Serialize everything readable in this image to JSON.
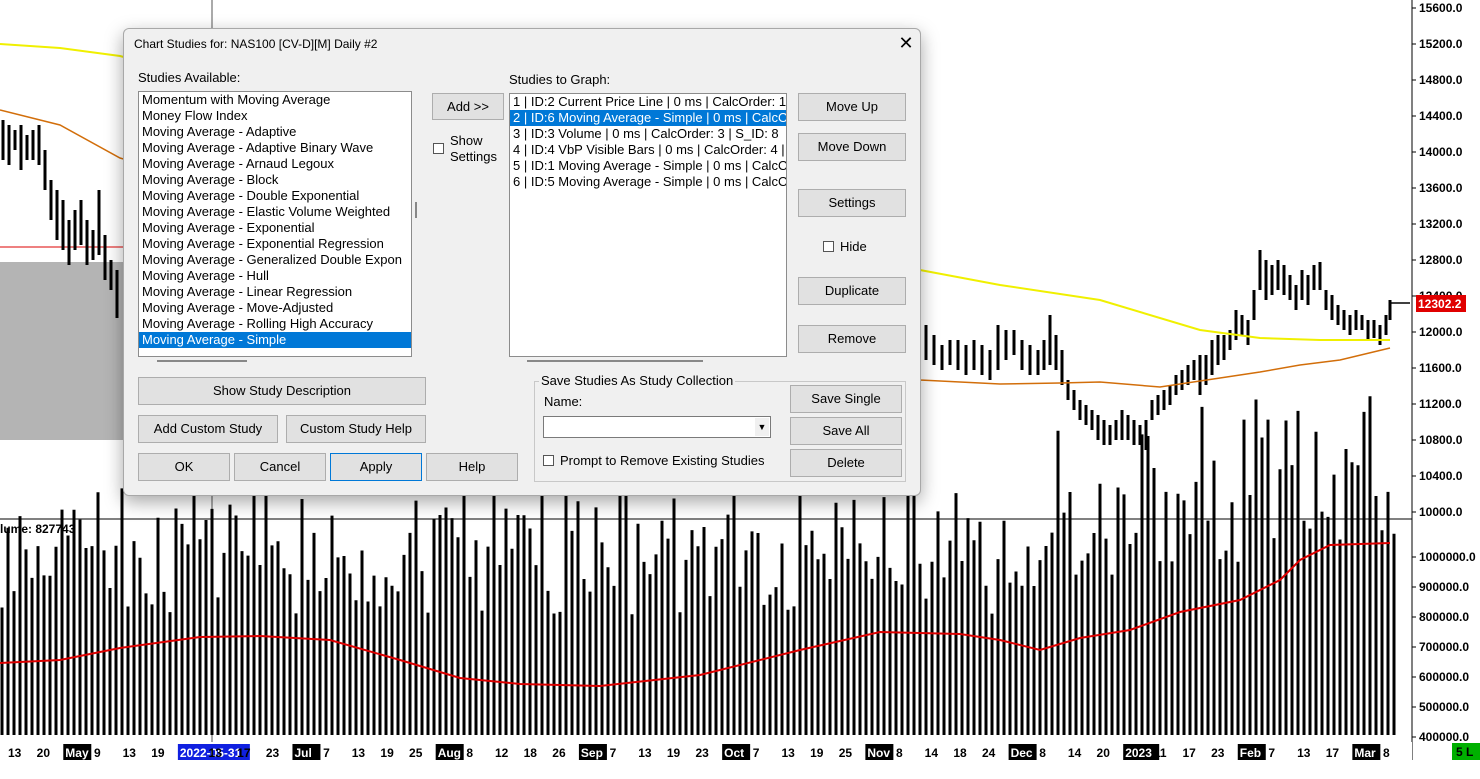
{
  "chart": {
    "price_axis_labels": [
      "15600.0",
      "15200.0",
      "14800.0",
      "14400.0",
      "14000.0",
      "13600.0",
      "13200.0",
      "12800.0",
      "12400.0",
      "12000.0",
      "11600.0",
      "11200.0",
      "10800.0",
      "10400.0",
      "10000.0"
    ],
    "current_price": "12302.2",
    "volume_title": "lume: 827743",
    "volume_axis_labels": [
      "1000000.0",
      "900000.0",
      "800000.0",
      "700000.0",
      "600000.0",
      "500000.0",
      "400000.0"
    ],
    "date_labels": [
      "13",
      "20",
      "May",
      "9",
      "13",
      "19",
      "2022-05-31",
      "13",
      "17",
      "23",
      "Jul",
      "7",
      "13",
      "19",
      "25",
      "Aug",
      "8",
      "12",
      "18",
      "26",
      "Sep",
      "7",
      "13",
      "19",
      "23",
      "Oct",
      "7",
      "13",
      "19",
      "25",
      "Nov",
      "8",
      "14",
      "18",
      "24",
      "Dec",
      "8",
      "14",
      "20",
      "2023",
      "11",
      "17",
      "23",
      "Feb",
      "7",
      "13",
      "17",
      "Mar",
      "8"
    ],
    "date_badge": "5 L",
    "colors": {
      "price_bars": "#000000",
      "ma_yellow": "#f0f000",
      "ma_orange": "#d26e0a",
      "volume_ma": "#dc0000",
      "price_badge": "#e00000",
      "date_selected": "#1020e0",
      "badge_green": "#00b000",
      "chart_bg": "#ffffff",
      "grey_block": "#b4b4b4"
    }
  },
  "dialog": {
    "title": "Chart Studies for: NAS100 [CV-D][M]  Daily  #2",
    "studies_available_label": "Studies Available:",
    "studies_available": [
      "Momentum with Moving Average",
      "Money Flow Index",
      "Moving Average - Adaptive",
      "Moving Average - Adaptive Binary Wave",
      "Moving Average - Arnaud Legoux",
      "Moving Average - Block",
      "Moving Average - Double Exponential",
      "Moving Average - Elastic Volume Weighted",
      "Moving Average - Exponential",
      "Moving Average - Exponential Regression",
      "Moving Average - Generalized Double Expon",
      "Moving Average - Hull",
      "Moving Average - Linear Regression",
      "Moving Average - Move-Adjusted",
      "Moving Average - Rolling High Accuracy",
      "Moving Average - Simple"
    ],
    "selected_available": "Moving Average - Simple",
    "add_button": "Add >>",
    "show_settings_1": "Show",
    "show_settings_2": "Settings",
    "studies_to_graph_label": "Studies to Graph:",
    "studies_to_graph": [
      "1 | ID:2  Current Price Line | 0 ms | CalcOrder: 1",
      "2 | ID:6  Moving Average - Simple | 0 ms | CalcO",
      "3 | ID:3  Volume | 0 ms | CalcOrder: 3 | S_ID: 8",
      "4 | ID:4  VbP Visible Bars | 0 ms | CalcOrder: 4 |",
      "5 | ID:1  Moving Average - Simple | 0 ms | CalcO",
      "6 | ID:5  Moving Average - Simple | 0 ms | CalcO"
    ],
    "selected_graph": "2 | ID:6  Moving Average - Simple | 0 ms | CalcO",
    "move_up": "Move Up",
    "move_down": "Move Down",
    "settings": "Settings",
    "hide": "Hide",
    "duplicate": "Duplicate",
    "remove": "Remove",
    "show_study_description": "Show Study Description",
    "add_custom_study": "Add Custom Study",
    "custom_study_help": "Custom Study Help",
    "ok": "OK",
    "cancel": "Cancel",
    "apply": "Apply",
    "help": "Help",
    "collection_group": "Save Studies As Study Collection",
    "name_label": "Name:",
    "name_value": "",
    "save_single": "Save Single",
    "save_all": "Save All",
    "delete": "Delete",
    "prompt_remove": "Prompt to Remove Existing Studies",
    "close_icon": "close-icon"
  }
}
